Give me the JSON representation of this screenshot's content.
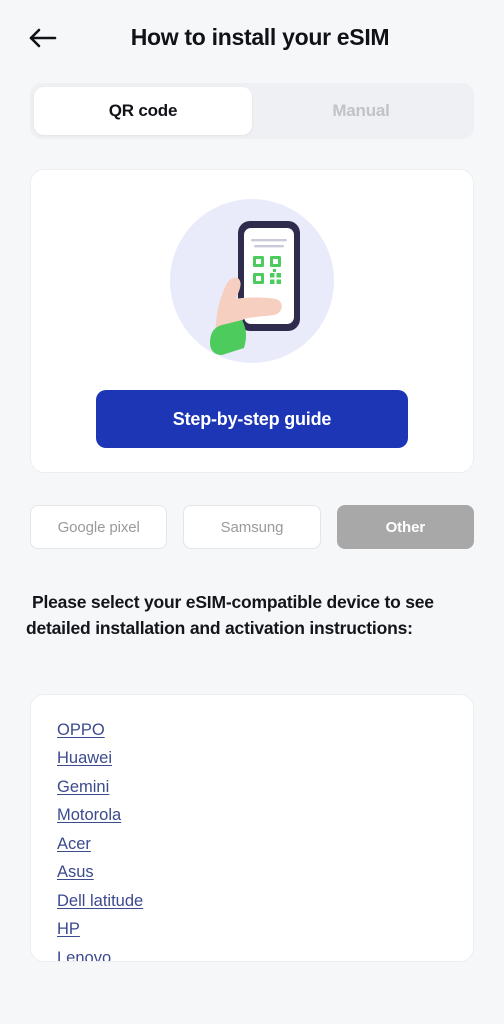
{
  "header": {
    "back_icon": "arrow-left-icon",
    "title": "How to install your eSIM"
  },
  "tabs": [
    {
      "label": "QR code",
      "state": "active"
    },
    {
      "label": "Manual",
      "state": "inactive"
    }
  ],
  "qr_card": {
    "illustration": "hand-holding-phone-with-qr-code-illustration",
    "cta_label": "Step-by-step guide"
  },
  "device_chips": [
    {
      "label": "Google pixel",
      "selected": false
    },
    {
      "label": "Samsung",
      "selected": false
    },
    {
      "label": "Other",
      "selected": true
    }
  ],
  "prompt": "Please select your eSIM-compatible device to see detailed installation and activation instructions:",
  "device_list": [
    {
      "label": "OPPO"
    },
    {
      "label": "Huawei"
    },
    {
      "label": "Gemini"
    },
    {
      "label": "Motorola"
    },
    {
      "label": "Acer"
    },
    {
      "label": "Asus"
    },
    {
      "label": "Dell latitude"
    },
    {
      "label": "HP"
    },
    {
      "label": "Lenovo"
    }
  ],
  "colors": {
    "page_background": "#f6f7f9",
    "primary_blue": "#1d36b5",
    "link_blue": "#3c4a8e",
    "selected_chip_gray": "#a8a8a8",
    "illustration_circle": "#e9ebfa",
    "phone_frame": "#2e2b4d",
    "qr_green": "#4ecb5d",
    "skin": "#f7cfc0"
  }
}
